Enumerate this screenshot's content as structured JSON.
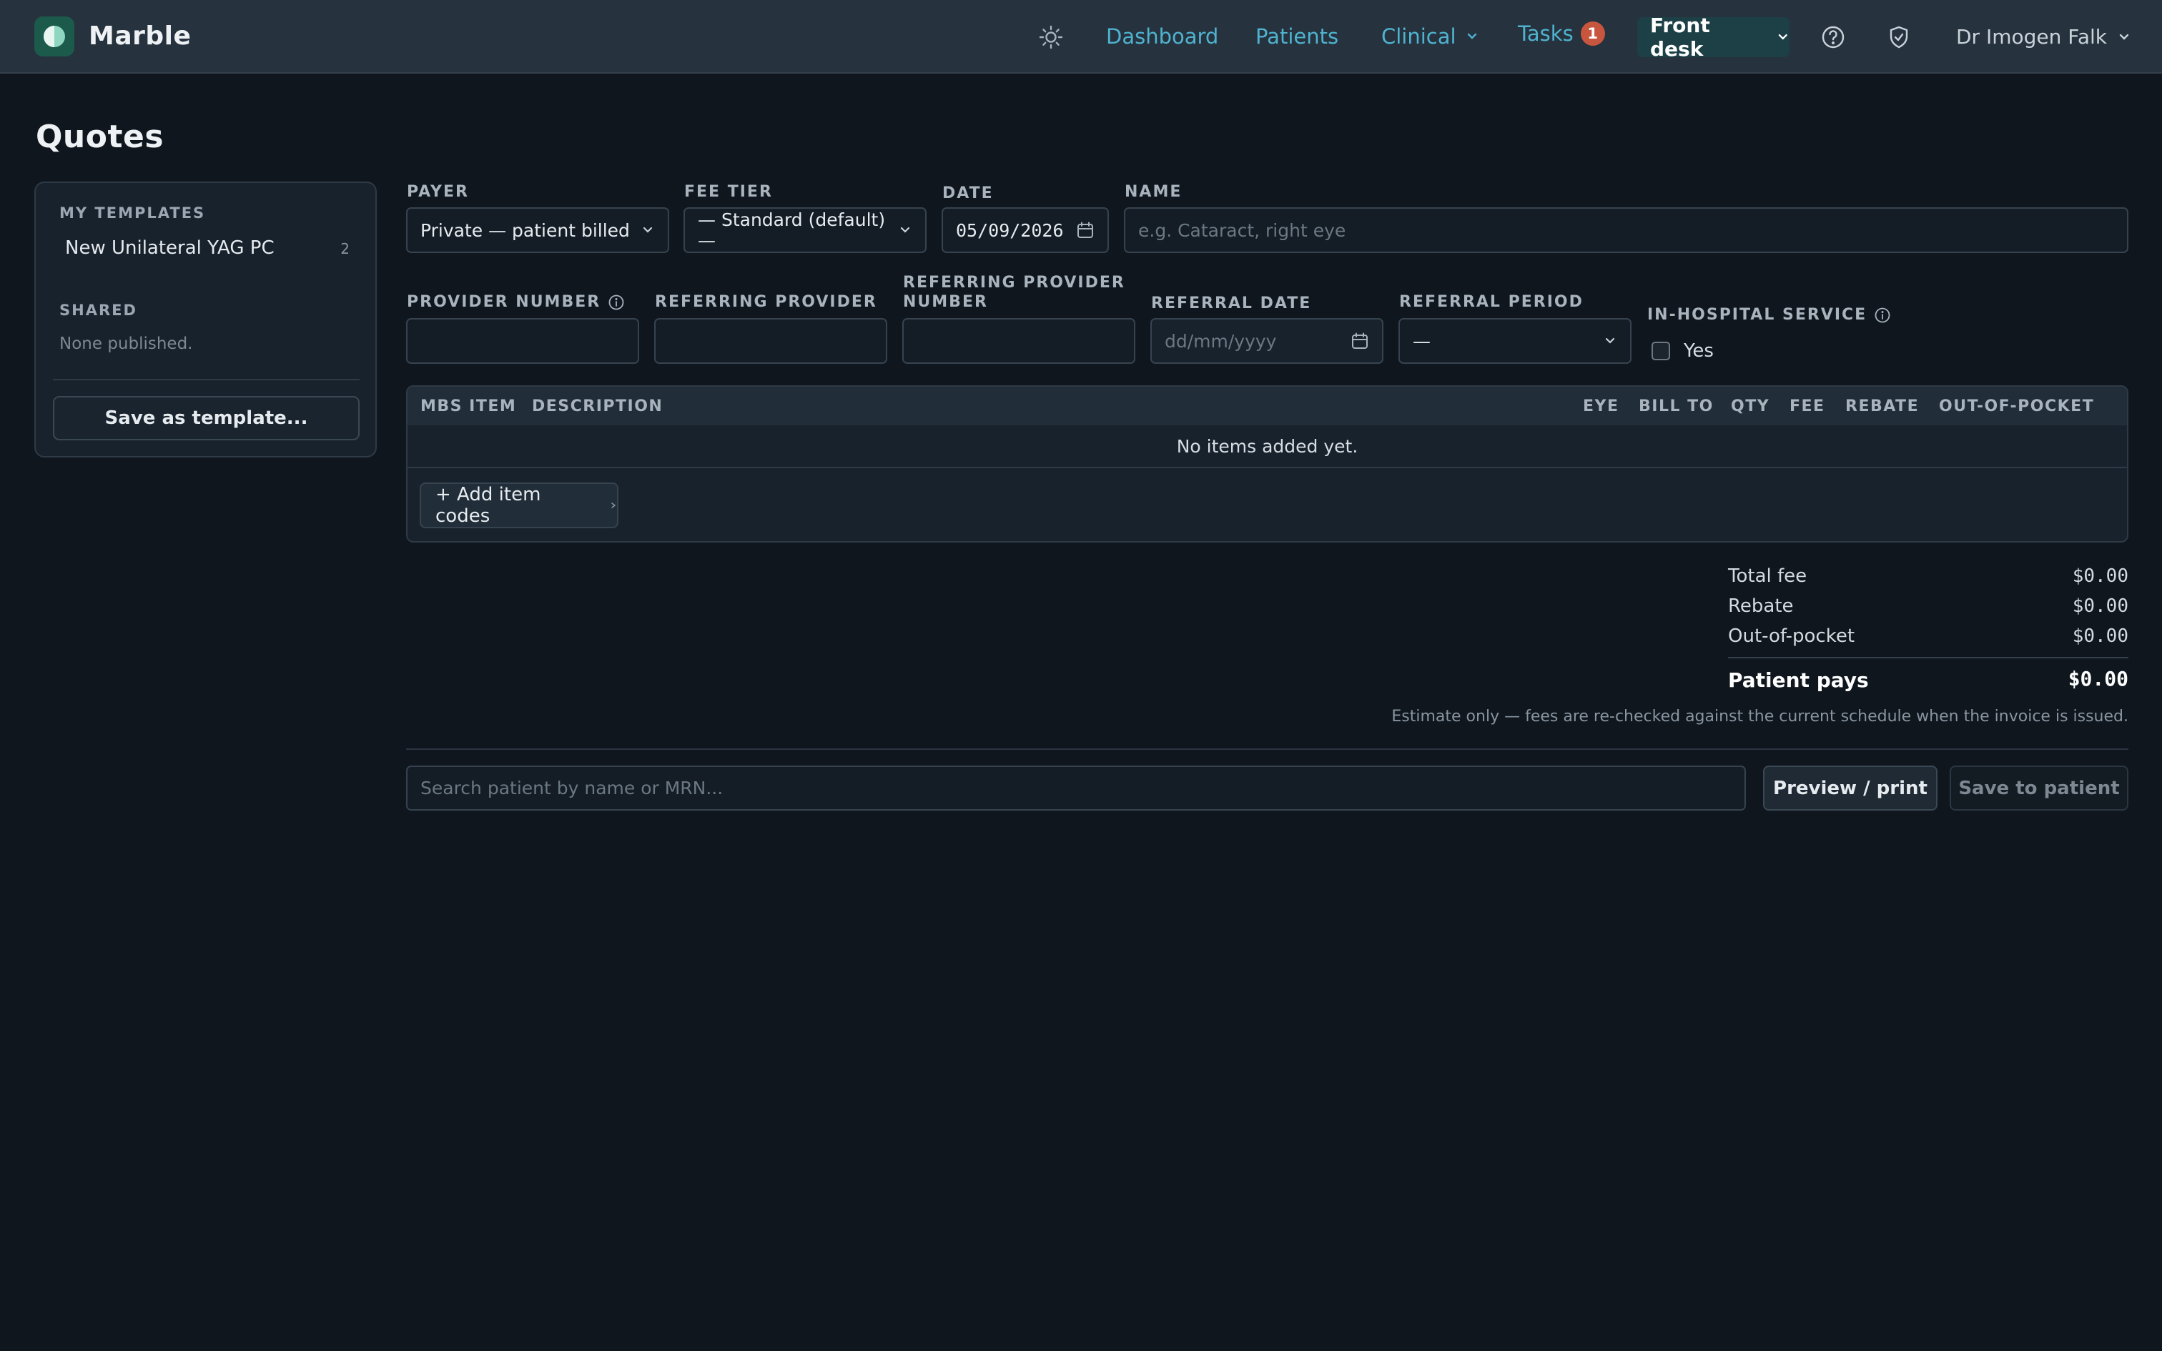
{
  "app": {
    "name": "Marble",
    "logo_icon": "half-circle-logo-icon"
  },
  "nav": {
    "theme_icon": "sun-icon",
    "dashboard": "Dashboard",
    "patients": "Patients",
    "clinical": "Clinical",
    "tasks": "Tasks",
    "tasks_count": "1",
    "front_desk": "Front desk",
    "help_icon": "help-circle-icon",
    "shield_icon": "shield-check-icon",
    "user": "Dr Imogen Falk"
  },
  "page": {
    "title": "Quotes"
  },
  "sidebar": {
    "my_templates_heading": "MY TEMPLATES",
    "templates": [
      {
        "name": "New Unilateral YAG PC",
        "count": "2"
      }
    ],
    "shared_heading": "SHARED",
    "shared_empty": "None published.",
    "save_template_label": "Save as template..."
  },
  "form": {
    "payer": {
      "label": "PAYER",
      "value": "Private — patient billed"
    },
    "fee_tier": {
      "label": "FEE TIER",
      "value": "— Standard (default) —"
    },
    "date": {
      "label": "DATE",
      "value": "05/09/2026"
    },
    "name": {
      "label": "NAME",
      "placeholder": "e.g. Cataract, right eye"
    },
    "provider_number": {
      "label": "PROVIDER NUMBER",
      "value": ""
    },
    "referring_provider": {
      "label": "REFERRING PROVIDER",
      "value": ""
    },
    "referring_provider_number": {
      "label": "REFERRING PROVIDER NUMBER",
      "value": ""
    },
    "referral_date": {
      "label": "REFERRAL DATE",
      "placeholder": "dd/mm/yyyy"
    },
    "referral_period": {
      "label": "REFERRAL PERIOD",
      "value": "—"
    },
    "in_hospital": {
      "label": "IN-HOSPITAL SERVICE",
      "option": "Yes",
      "checked": false
    }
  },
  "table": {
    "columns": [
      "MBS ITEM",
      "DESCRIPTION",
      "EYE",
      "BILL TO",
      "QTY",
      "FEE",
      "REBATE",
      "OUT-OF-POCKET"
    ],
    "empty_message": "No items added yet.",
    "add_label": "+ Add item codes"
  },
  "totals": {
    "total_fee_label": "Total fee",
    "total_fee": "$0.00",
    "rebate_label": "Rebate",
    "rebate": "$0.00",
    "oop_label": "Out-of-pocket",
    "oop": "$0.00",
    "patient_pays_label": "Patient pays",
    "patient_pays": "$0.00",
    "note": "Estimate only — fees are re-checked against the current schedule when the invoice is issued."
  },
  "footer": {
    "search_placeholder": "Search patient by name or MRN...",
    "preview_label": "Preview / print",
    "save_label": "Save to patient"
  },
  "colors": {
    "accent_link": "#4fb3d0",
    "badge": "#c8563f",
    "brand_tile": "#1c5a4c"
  }
}
